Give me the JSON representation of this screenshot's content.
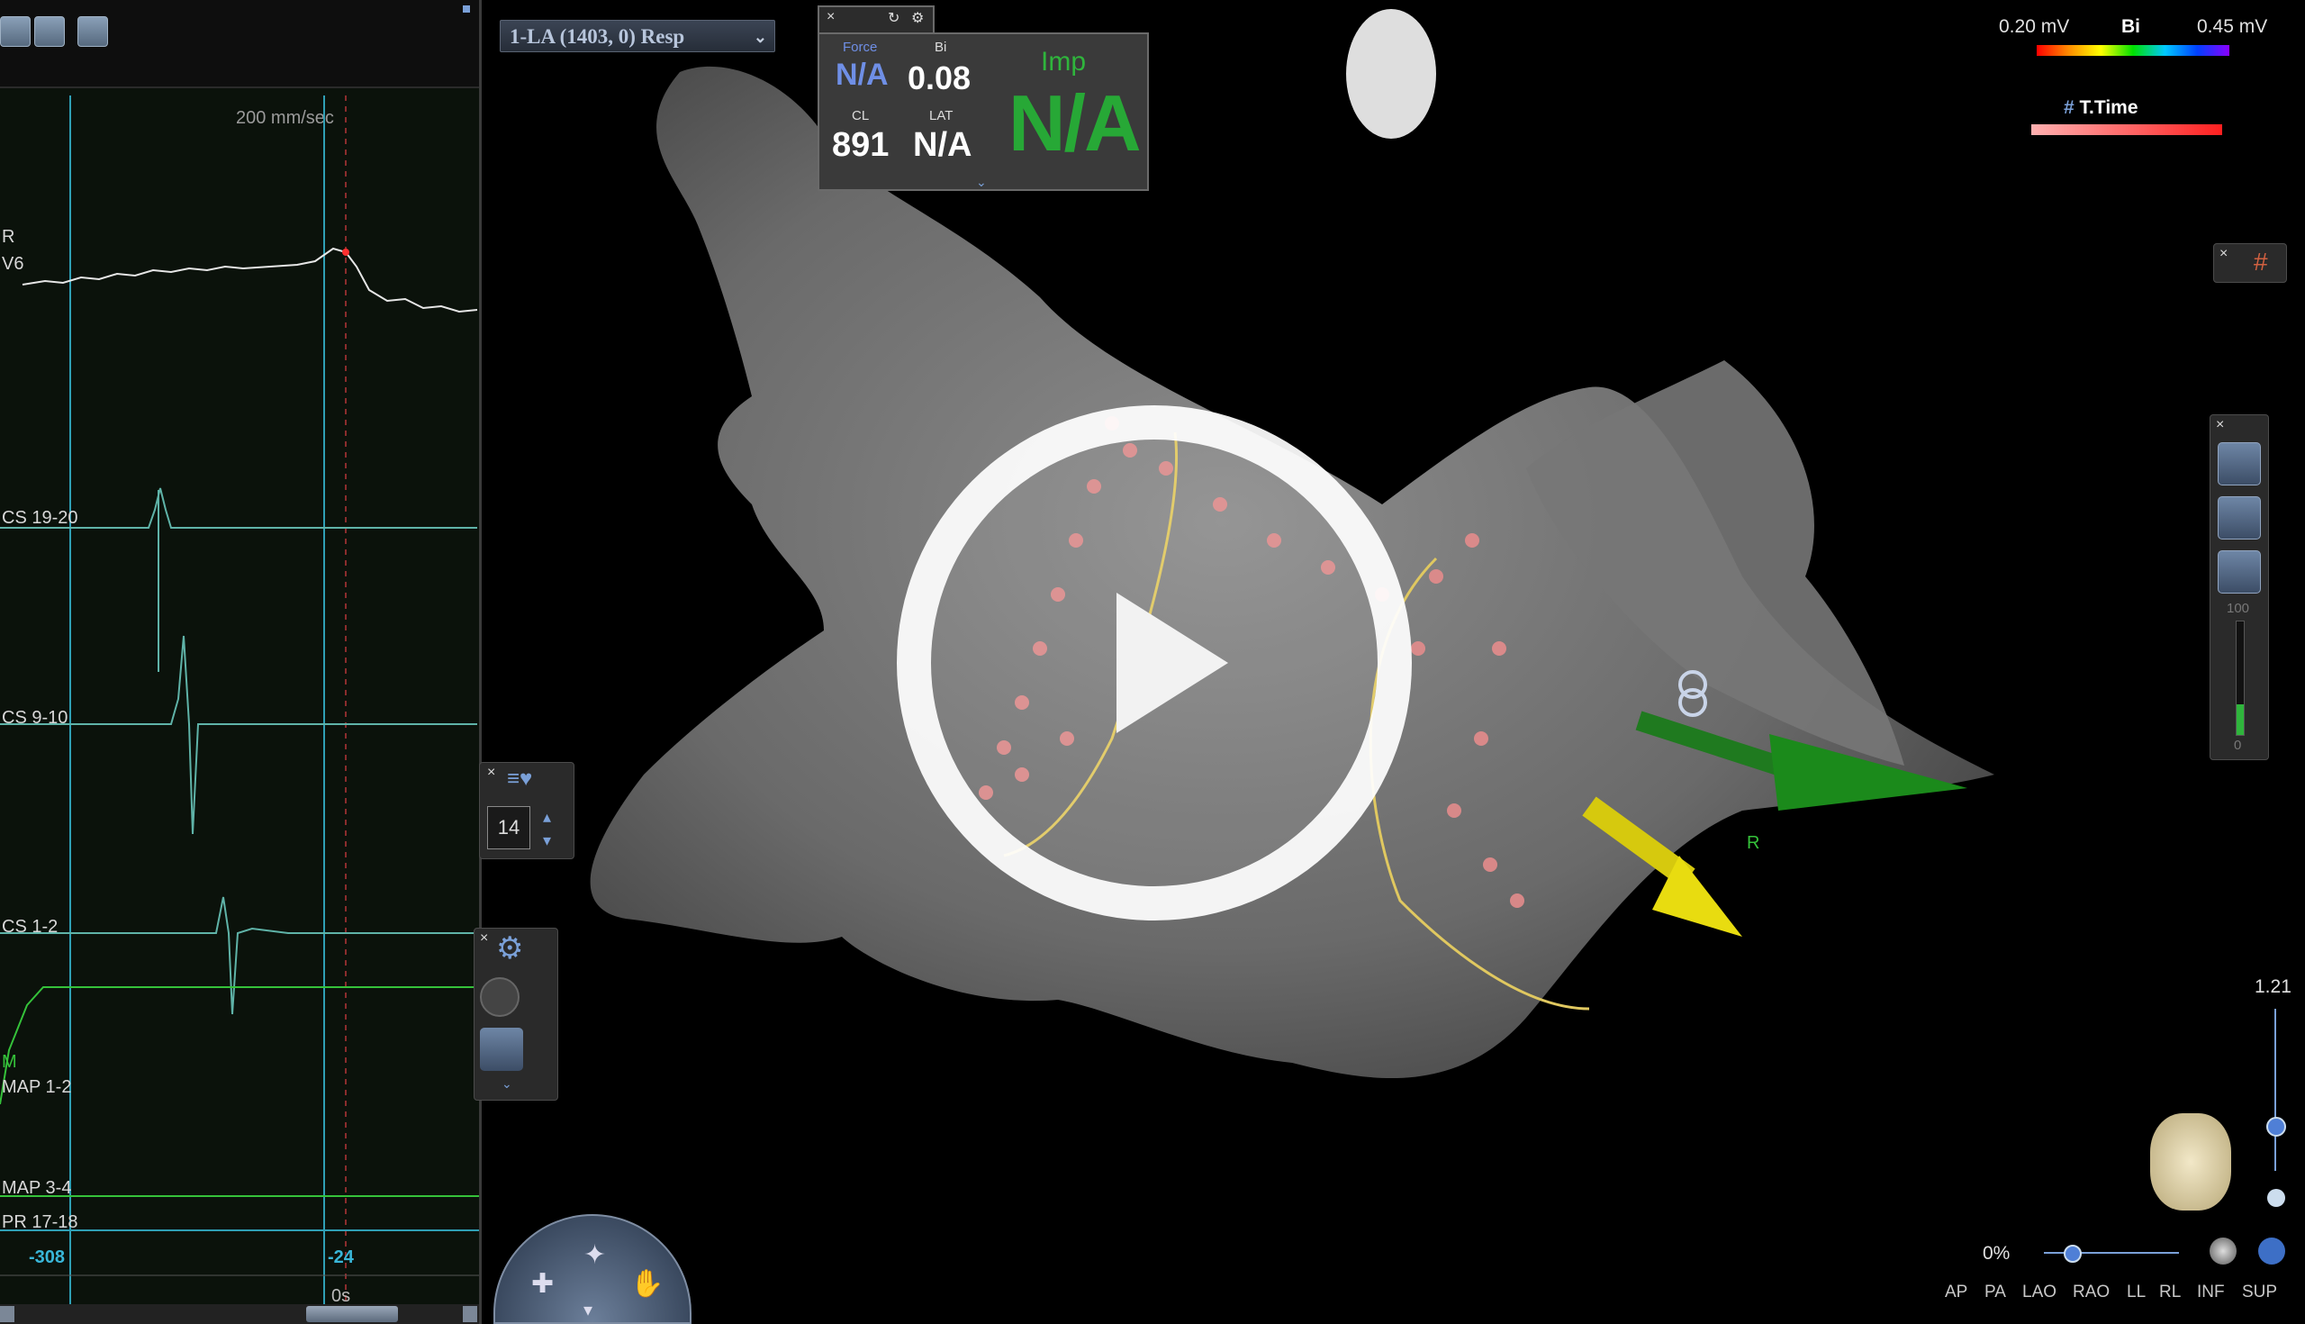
{
  "ecg": {
    "speed": "200 mm/sec",
    "channels": [
      {
        "label": "R"
      },
      {
        "label": "V6"
      },
      {
        "label": "CS 19-20"
      },
      {
        "label": "CS 9-10"
      },
      {
        "label": "CS 1-2"
      },
      {
        "label": "M"
      },
      {
        "label": "MAP 1-2"
      },
      {
        "label": "MAP 3-4"
      },
      {
        "label": "PR 17-18"
      }
    ],
    "time_left": "-308",
    "time_right": "-24",
    "time_zero": "0s"
  },
  "map": {
    "selector": "1-LA (1403, 0) Resp",
    "catheter_box": {
      "force_label": "Force",
      "force_value": "N/A",
      "bi_label": "Bi",
      "bi_value": "0.08",
      "cl_label": "CL",
      "cl_value": "891",
      "lat_label": "LAT",
      "lat_value": "N/A",
      "imp_label": "Imp",
      "imp_value": "N/A"
    },
    "scale": {
      "min": "0.20 mV",
      "mode": "Bi",
      "max": "0.45 mV",
      "ttime_label": "T.Time"
    },
    "point_panel": {
      "count": "14"
    },
    "level_panel": {
      "top": "100",
      "bottom": "0"
    },
    "zoom": "1.21",
    "opacity": "0%",
    "views": [
      "AP",
      "PA",
      "LAO",
      "RAO",
      "LL",
      "RL",
      "INF",
      "SUP"
    ],
    "marker_r": "R"
  },
  "colors": {
    "accent_blue": "#39b6d8",
    "imp_green": "#27a836",
    "force_blue": "#6f8fe6",
    "ecg_trace": "#5fb3a8",
    "map_trace": "#35c23a"
  }
}
